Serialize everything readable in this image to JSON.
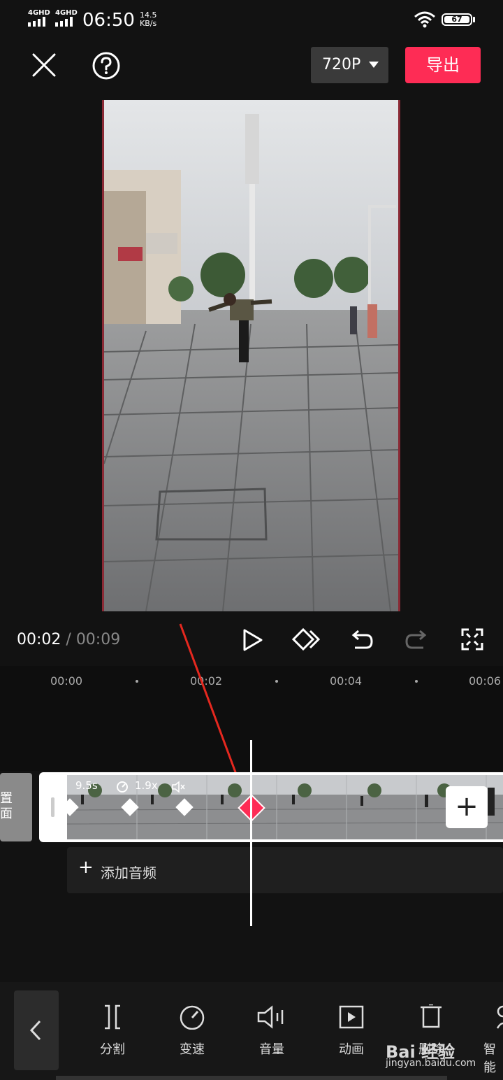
{
  "status_bar": {
    "network1": "4GHD",
    "network2": "4GHD",
    "clock": "06:50",
    "speed_value": "14.5",
    "speed_unit": "KB/s",
    "battery": "67"
  },
  "header": {
    "resolution": "720P",
    "export_label": "导出"
  },
  "playback": {
    "current_time": "00:02",
    "separator": " / ",
    "total_time": "00:09"
  },
  "ruler": {
    "ticks": [
      "00:00",
      "00:02",
      "00:04",
      "00:06"
    ]
  },
  "timeline": {
    "prev_clip_line1": "置",
    "prev_clip_line2": "面",
    "clip_duration": "9.5s",
    "clip_speed": "1.9x",
    "add_audio_label": "添加音频"
  },
  "toolbar": {
    "items": [
      {
        "label": "分割",
        "icon": "split-icon"
      },
      {
        "label": "变速",
        "icon": "speed-icon"
      },
      {
        "label": "音量",
        "icon": "volume-icon"
      },
      {
        "label": "动画",
        "icon": "animation-icon"
      },
      {
        "label": "删除",
        "icon": "delete-icon"
      },
      {
        "label": "智能",
        "icon": "smart-icon"
      }
    ]
  },
  "watermark": {
    "brand": "Bai 经验",
    "url": "jingyan.baidu.com"
  },
  "colors": {
    "accent": "#fe2c55",
    "background": "#121212"
  }
}
